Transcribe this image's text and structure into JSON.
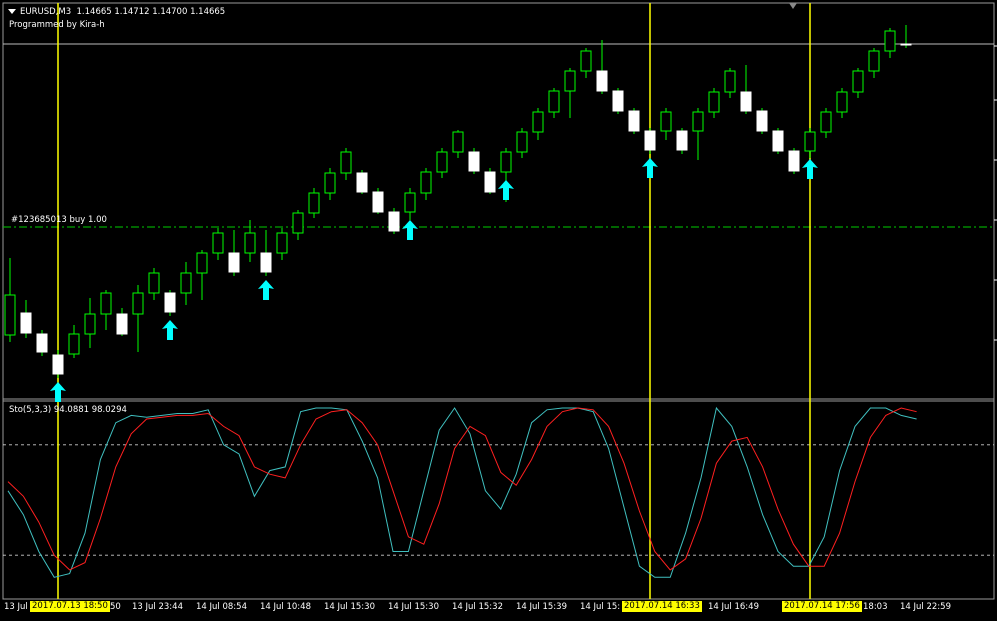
{
  "header": {
    "symbol": "EURUSD,M3",
    "ohlc": "1.14665 1.14712 1.14700 1.14665",
    "subtitle": "Programmed by Kira-h"
  },
  "order_line": {
    "label": "#123685013 buy 1.00"
  },
  "indicator": {
    "label": "Sto(5,3,3) 94.0881 98.0294"
  },
  "time_axis": {
    "ticks": [
      "13 Jul",
      "50",
      "13 Jul 23:44",
      "14 Jul 08:54",
      "14 Jul 10:48",
      "14 Jul 15:30",
      "14 Jul 15:30",
      "14 Jul 15:32",
      "14 Jul 15:39",
      "14 Jul 15:",
      "14 Jul 16:49",
      "18:03",
      "14 Jul 22:59"
    ],
    "highlights": [
      "2017.07.13 18:50",
      "2017.07.14 16:33",
      "2017.07.14 17:56"
    ]
  },
  "colors": {
    "background": "#000000",
    "bull_candle": "#00ff00",
    "bear_candle": "#ffffff",
    "signal_arrow": "#00ffff",
    "vertical_marker": "#ffff00",
    "order_line": "#00cc00",
    "stoch_main": "#40c0c0",
    "stoch_signal": "#ff2020",
    "stoch_levels": "#ffffff"
  },
  "icons": {
    "menu": "triangle-down-icon",
    "signal": "arrow-up-icon"
  },
  "chart_data": [
    {
      "type": "candlestick",
      "title": "EURUSD,M3",
      "y_range_px_relative": "price",
      "candles": [
        {
          "o": 335,
          "h": 258,
          "l": 342,
          "c": 295
        },
        {
          "o": 313,
          "h": 300,
          "l": 338,
          "c": 333
        },
        {
          "o": 334,
          "h": 330,
          "l": 356,
          "c": 352
        },
        {
          "o": 355,
          "h": 350,
          "l": 378,
          "c": 374
        },
        {
          "o": 354,
          "h": 325,
          "l": 358,
          "c": 334
        },
        {
          "o": 334,
          "h": 298,
          "l": 348,
          "c": 314
        },
        {
          "o": 314,
          "h": 290,
          "l": 330,
          "c": 293
        },
        {
          "o": 314,
          "h": 308,
          "l": 336,
          "c": 334
        },
        {
          "o": 314,
          "h": 285,
          "l": 352,
          "c": 293
        },
        {
          "o": 293,
          "h": 268,
          "l": 300,
          "c": 273
        },
        {
          "o": 293,
          "h": 290,
          "l": 316,
          "c": 312
        },
        {
          "o": 293,
          "h": 262,
          "l": 305,
          "c": 273
        },
        {
          "o": 273,
          "h": 250,
          "l": 300,
          "c": 253
        },
        {
          "o": 253,
          "h": 228,
          "l": 260,
          "c": 233
        },
        {
          "o": 253,
          "h": 230,
          "l": 276,
          "c": 272
        },
        {
          "o": 253,
          "h": 220,
          "l": 262,
          "c": 233
        },
        {
          "o": 253,
          "h": 230,
          "l": 276,
          "c": 272
        },
        {
          "o": 253,
          "h": 228,
          "l": 260,
          "c": 233
        },
        {
          "o": 233,
          "h": 210,
          "l": 240,
          "c": 213
        },
        {
          "o": 213,
          "h": 188,
          "l": 218,
          "c": 193
        },
        {
          "o": 193,
          "h": 168,
          "l": 200,
          "c": 173
        },
        {
          "o": 173,
          "h": 148,
          "l": 180,
          "c": 152
        },
        {
          "o": 173,
          "h": 170,
          "l": 194,
          "c": 192
        },
        {
          "o": 192,
          "h": 188,
          "l": 214,
          "c": 212
        },
        {
          "o": 212,
          "h": 208,
          "l": 234,
          "c": 231
        },
        {
          "o": 212,
          "h": 188,
          "l": 220,
          "c": 193
        },
        {
          "o": 193,
          "h": 168,
          "l": 200,
          "c": 172
        },
        {
          "o": 172,
          "h": 148,
          "l": 178,
          "c": 152
        },
        {
          "o": 152,
          "h": 130,
          "l": 158,
          "c": 132
        },
        {
          "o": 152,
          "h": 148,
          "l": 174,
          "c": 171
        },
        {
          "o": 172,
          "h": 168,
          "l": 194,
          "c": 192
        },
        {
          "o": 172,
          "h": 148,
          "l": 202,
          "c": 152
        },
        {
          "o": 152,
          "h": 128,
          "l": 158,
          "c": 132
        },
        {
          "o": 132,
          "h": 108,
          "l": 140,
          "c": 112
        },
        {
          "o": 112,
          "h": 88,
          "l": 118,
          "c": 91
        },
        {
          "o": 91,
          "h": 68,
          "l": 118,
          "c": 71
        },
        {
          "o": 71,
          "h": 48,
          "l": 78,
          "c": 51
        },
        {
          "o": 71,
          "h": 40,
          "l": 94,
          "c": 91
        },
        {
          "o": 91,
          "h": 88,
          "l": 114,
          "c": 111
        },
        {
          "o": 111,
          "h": 108,
          "l": 134,
          "c": 131
        },
        {
          "o": 131,
          "h": 128,
          "l": 154,
          "c": 150
        },
        {
          "o": 131,
          "h": 108,
          "l": 140,
          "c": 112
        },
        {
          "o": 131,
          "h": 128,
          "l": 154,
          "c": 150
        },
        {
          "o": 131,
          "h": 108,
          "l": 160,
          "c": 112
        },
        {
          "o": 112,
          "h": 88,
          "l": 118,
          "c": 92
        },
        {
          "o": 92,
          "h": 68,
          "l": 98,
          "c": 71
        },
        {
          "o": 92,
          "h": 65,
          "l": 114,
          "c": 111
        },
        {
          "o": 111,
          "h": 108,
          "l": 134,
          "c": 131
        },
        {
          "o": 131,
          "h": 128,
          "l": 154,
          "c": 151
        },
        {
          "o": 151,
          "h": 148,
          "l": 174,
          "c": 171
        },
        {
          "o": 151,
          "h": 128,
          "l": 158,
          "c": 132
        },
        {
          "o": 132,
          "h": 108,
          "l": 138,
          "c": 112
        },
        {
          "o": 112,
          "h": 88,
          "l": 118,
          "c": 92
        },
        {
          "o": 92,
          "h": 68,
          "l": 98,
          "c": 71
        },
        {
          "o": 71,
          "h": 48,
          "l": 78,
          "c": 51
        },
        {
          "o": 51,
          "h": 28,
          "l": 58,
          "c": 31
        },
        {
          "o": 44,
          "h": 25,
          "l": 48,
          "c": 45
        }
      ],
      "arrows": [
        3,
        10,
        16,
        25,
        31,
        40,
        50
      ],
      "markers_at_candle": [
        3,
        40,
        50
      ]
    },
    {
      "type": "line",
      "title": "Sto(5,3,3) 94.0881 98.0294",
      "ylim": [
        0,
        100
      ],
      "levels": [
        80,
        20
      ],
      "series": [
        {
          "name": "Sto(5,3,3) 94.0881",
          "values": [
            55,
            42,
            22,
            8,
            10,
            32,
            72,
            92,
            96,
            95,
            96,
            97,
            97,
            99,
            80,
            75,
            52,
            66,
            68,
            98,
            100,
            100,
            99,
            82,
            62,
            22,
            22,
            55,
            88,
            100,
            86,
            55,
            45,
            64,
            92,
            99,
            100,
            100,
            98,
            78,
            46,
            14,
            8,
            8,
            32,
            62,
            100,
            90,
            68,
            42,
            22,
            14,
            14,
            30,
            66,
            90,
            100,
            100,
            96,
            94
          ]
        },
        {
          "name": "",
          "values": [
            60,
            52,
            38,
            20,
            12,
            16,
            40,
            68,
            86,
            94,
            95,
            96,
            96,
            97,
            90,
            85,
            68,
            64,
            62,
            80,
            94,
            98,
            99,
            92,
            80,
            55,
            30,
            26,
            48,
            78,
            90,
            85,
            65,
            58,
            72,
            90,
            98,
            100,
            99,
            90,
            70,
            44,
            22,
            12,
            18,
            40,
            70,
            82,
            84,
            68,
            45,
            26,
            14,
            14,
            32,
            60,
            84,
            96,
            100,
            98
          ]
        }
      ]
    }
  ]
}
